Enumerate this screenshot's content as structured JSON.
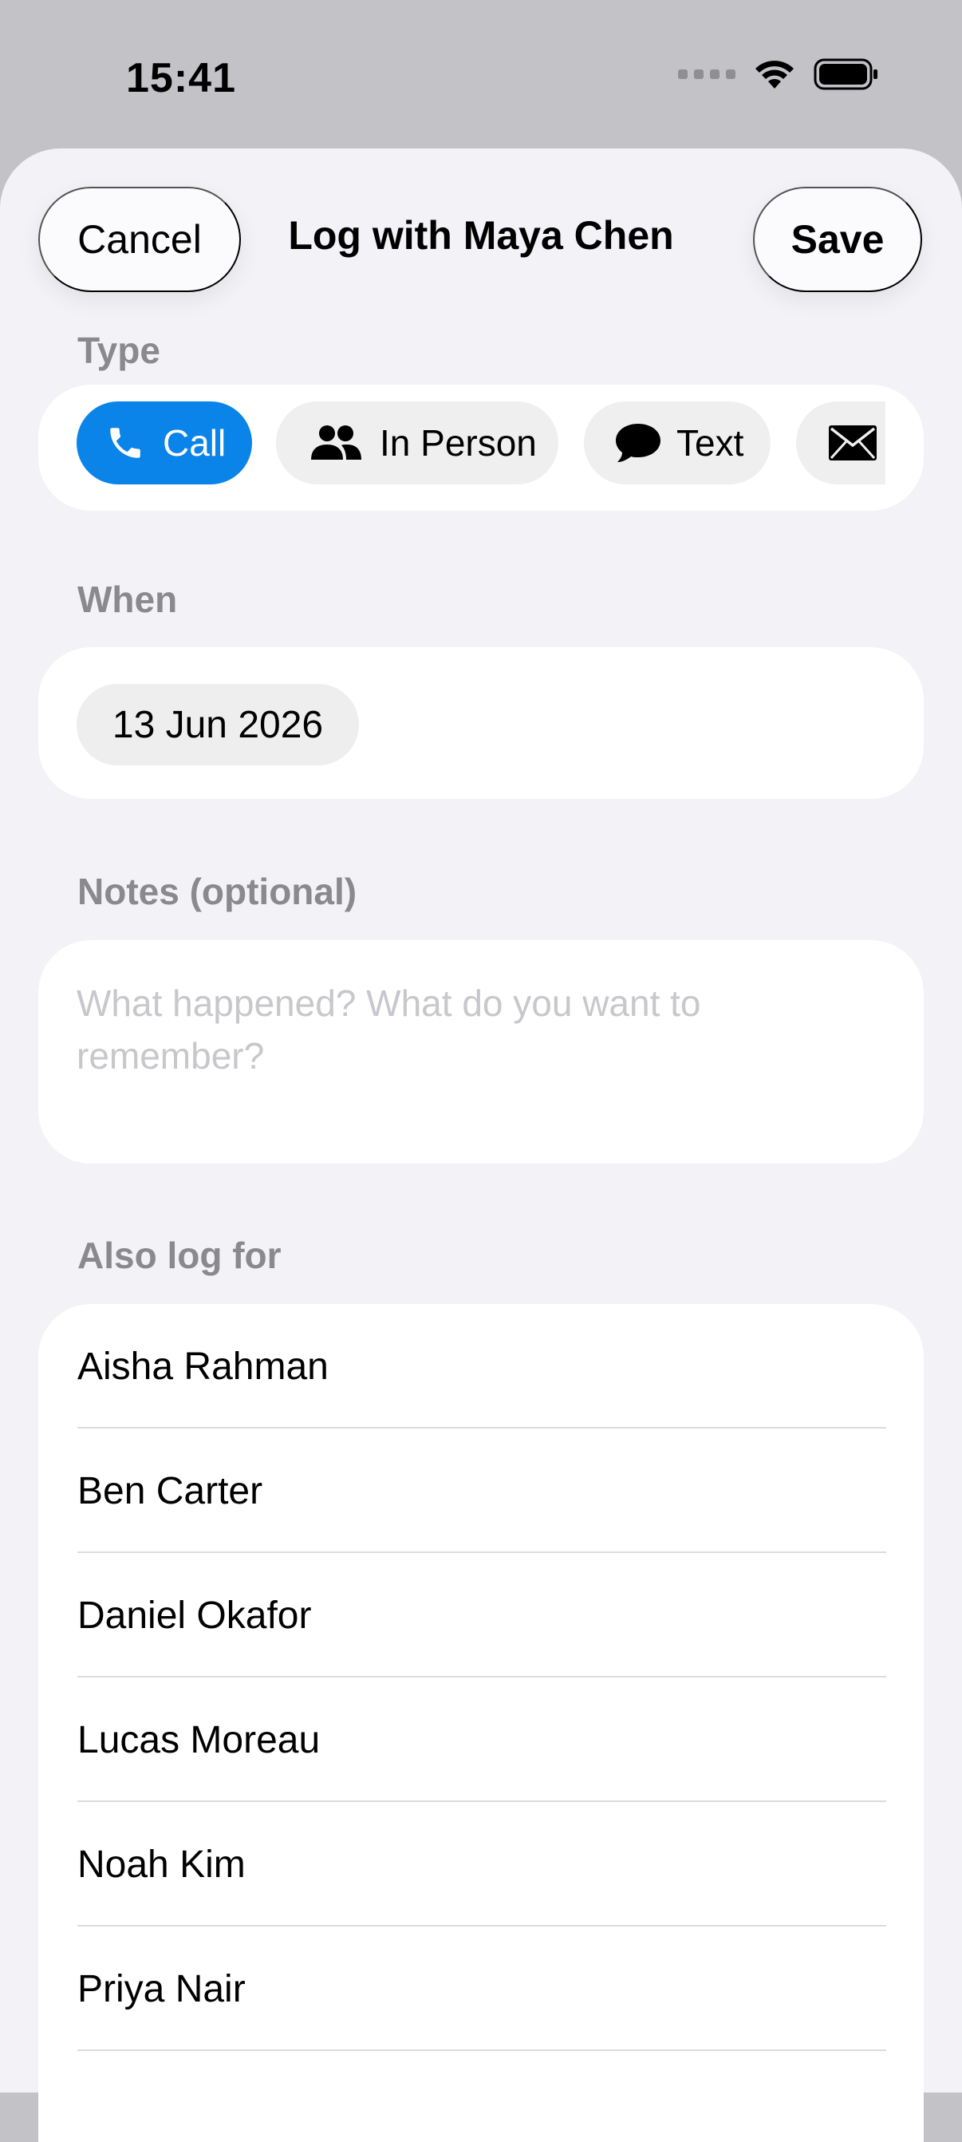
{
  "status_bar": {
    "time": "15:41"
  },
  "sheet": {
    "title": "Log with Maya Chen",
    "cancel_label": "Cancel",
    "save_label": "Save"
  },
  "type_section": {
    "label": "Type",
    "options": [
      {
        "label": "Call",
        "icon": "phone-icon",
        "selected": true
      },
      {
        "label": "In Person",
        "icon": "people-icon",
        "selected": false
      },
      {
        "label": "Text",
        "icon": "speech-bubble-icon",
        "selected": false
      },
      {
        "label": "",
        "icon": "envelope-icon",
        "selected": false
      }
    ]
  },
  "when_section": {
    "label": "When",
    "date": "13 Jun 2026"
  },
  "notes_section": {
    "label": "Notes (optional)",
    "value": "",
    "placeholder": "What happened? What do you want to remember?"
  },
  "also_log_section": {
    "label": "Also log for",
    "people": [
      "Aisha Rahman",
      "Ben Carter",
      "Daniel Okafor",
      "Lucas Moreau",
      "Noah Kim",
      "Priya Nair"
    ]
  },
  "colors": {
    "accent": "#0a84e8",
    "sheet_background": "#f2f2f7",
    "section_label": "#8a8a8e",
    "placeholder": "#c7c7cc"
  }
}
